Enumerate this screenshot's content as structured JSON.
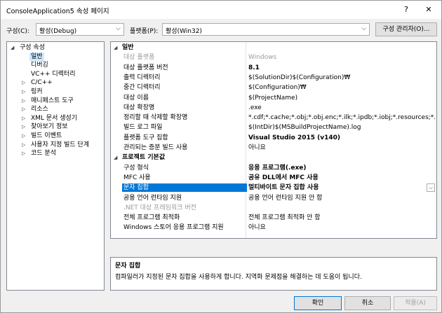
{
  "window": {
    "title": "ConsoleApplication5 속성 페이지",
    "help_label": "?",
    "close_label": "✕"
  },
  "config_bar": {
    "config_label": "구성(C):",
    "config_value": "활성(Debug)",
    "platform_label": "플랫폼(P):",
    "platform_value": "활성(Win32)",
    "config_manager_label": "구성 관리자(O)..."
  },
  "tree": {
    "items": [
      {
        "label": "구성 속성",
        "expander": "◢",
        "level": 0
      },
      {
        "label": "일반",
        "expander": "",
        "level": 1,
        "selected": true
      },
      {
        "label": "디버깅",
        "expander": "",
        "level": 1
      },
      {
        "label": "VC++ 디렉터리",
        "expander": "",
        "level": 1
      },
      {
        "label": "C/C++",
        "expander": "▷",
        "level": 1
      },
      {
        "label": "링커",
        "expander": "▷",
        "level": 1
      },
      {
        "label": "매니페스트 도구",
        "expander": "▷",
        "level": 1
      },
      {
        "label": "리소스",
        "expander": "▷",
        "level": 1
      },
      {
        "label": "XML 문서 생성기",
        "expander": "▷",
        "level": 1
      },
      {
        "label": "찾아보기 정보",
        "expander": "▷",
        "level": 1
      },
      {
        "label": "빌드 이벤트",
        "expander": "▷",
        "level": 1
      },
      {
        "label": "사용자 지정 빌드 단계",
        "expander": "▷",
        "level": 1
      },
      {
        "label": "코드 분석",
        "expander": "▷",
        "level": 1
      }
    ]
  },
  "grid": {
    "rows": [
      {
        "type": "category",
        "label": "일반",
        "expander": "◢"
      },
      {
        "type": "prop",
        "name": "대상 플랫폼",
        "value": "Windows",
        "dim": true
      },
      {
        "type": "prop",
        "name": "대상 플랫폼 버전",
        "value": "8.1",
        "bold": true
      },
      {
        "type": "prop",
        "name": "출력 디렉터리",
        "value": "$(SolutionDir)$(Configuration)₩"
      },
      {
        "type": "prop",
        "name": "중간 디렉터리",
        "value": "$(Configuration)₩"
      },
      {
        "type": "prop",
        "name": "대상 이름",
        "value": "$(ProjectName)"
      },
      {
        "type": "prop",
        "name": "대상 확장명",
        "value": ".exe"
      },
      {
        "type": "prop",
        "name": "정리할 때 삭제할 확장명",
        "value": "*.cdf;*.cache;*.obj;*.obj.enc;*.ilk;*.ipdb;*.iobj;*.resources;*.tlb;*.tli;*.tl"
      },
      {
        "type": "prop",
        "name": "빌드 로그 파일",
        "value": "$(IntDir)$(MSBuildProjectName).log"
      },
      {
        "type": "prop",
        "name": "플랫폼 도구 집합",
        "value": "Visual Studio 2015 (v140)",
        "bold": true
      },
      {
        "type": "prop",
        "name": "관리되는 증분 빌드 사용",
        "value": "아니요"
      },
      {
        "type": "category",
        "label": "프로젝트 기본값",
        "expander": "◢"
      },
      {
        "type": "prop",
        "name": "구성 형식",
        "value": "응용 프로그램(.exe)",
        "bold": true
      },
      {
        "type": "prop",
        "name": "MFC 사용",
        "value": "공유 DLL에서 MFC 사용",
        "bold": true
      },
      {
        "type": "prop",
        "name": "문자 집합",
        "value": "멀티바이트 문자 집합 사용",
        "bold": true,
        "selected": true
      },
      {
        "type": "prop",
        "name": "공용 언어 런타임 지원",
        "value": "공용 언어 런타임 지원 안 함"
      },
      {
        "type": "prop",
        "name": ".NET 대상 프레임워크 버전",
        "value": "",
        "dim": true
      },
      {
        "type": "prop",
        "name": "전체 프로그램 최적화",
        "value": "전체 프로그램 최적화 안 함"
      },
      {
        "type": "prop",
        "name": "Windows 스토어 응용 프로그램 지원",
        "value": "아니요"
      }
    ],
    "dropdown_icon": "chevron-down-icon",
    "dropdown_glyph": "⌵"
  },
  "description": {
    "title": "문자 집합",
    "text": "컴파일러가 지정된 문자 집합을 사용하게 합니다. 지역화 문제점을 해결하는 데 도움이 됩니다."
  },
  "buttons": {
    "ok": "확인",
    "cancel": "취소",
    "apply": "적용(A)"
  },
  "colors": {
    "selection": "#0078d7",
    "tree_selection": "#cce8ff"
  }
}
